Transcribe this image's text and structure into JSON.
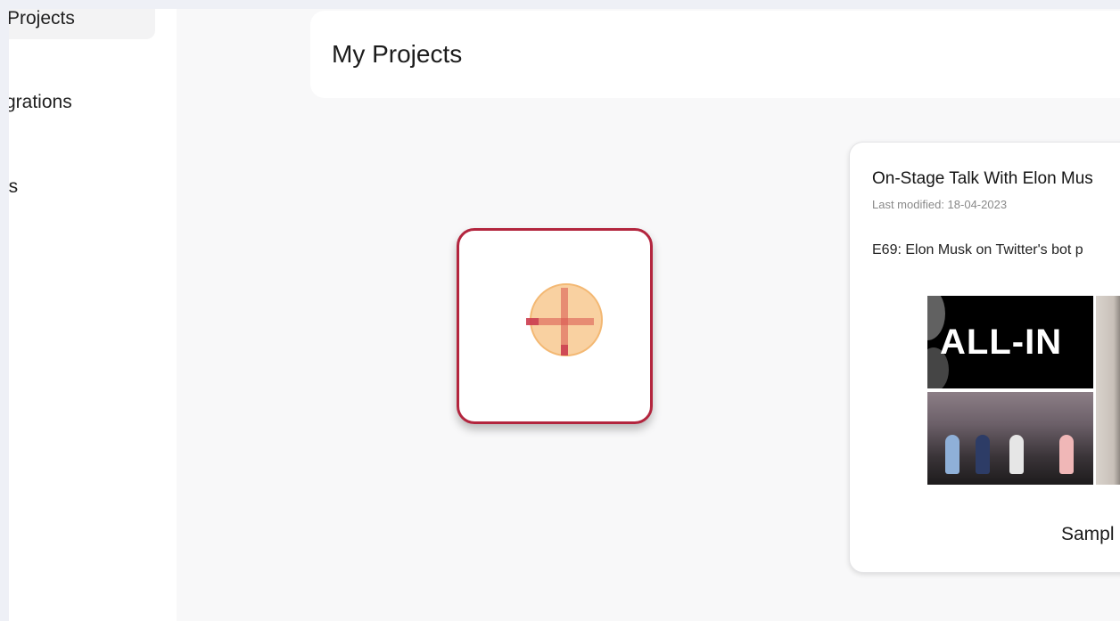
{
  "sidebar": {
    "items": [
      {
        "label": "Projects",
        "active": true
      },
      {
        "label": "grations",
        "active": false
      },
      {
        "label": "ns",
        "active": false
      }
    ]
  },
  "header": {
    "title": "My Projects"
  },
  "new_project": {
    "icon": "plus-circle-icon",
    "accent": "#b3253e",
    "icon_color": "#f8c990"
  },
  "projects": [
    {
      "title": "On-Stage Talk With Elon Mus",
      "last_modified": "Last modified: 18-04-2023",
      "description": "E69: Elon Musk on Twitter's bot p",
      "thumbnail_text": "ALL-IN",
      "tag": "Sampl"
    }
  ]
}
